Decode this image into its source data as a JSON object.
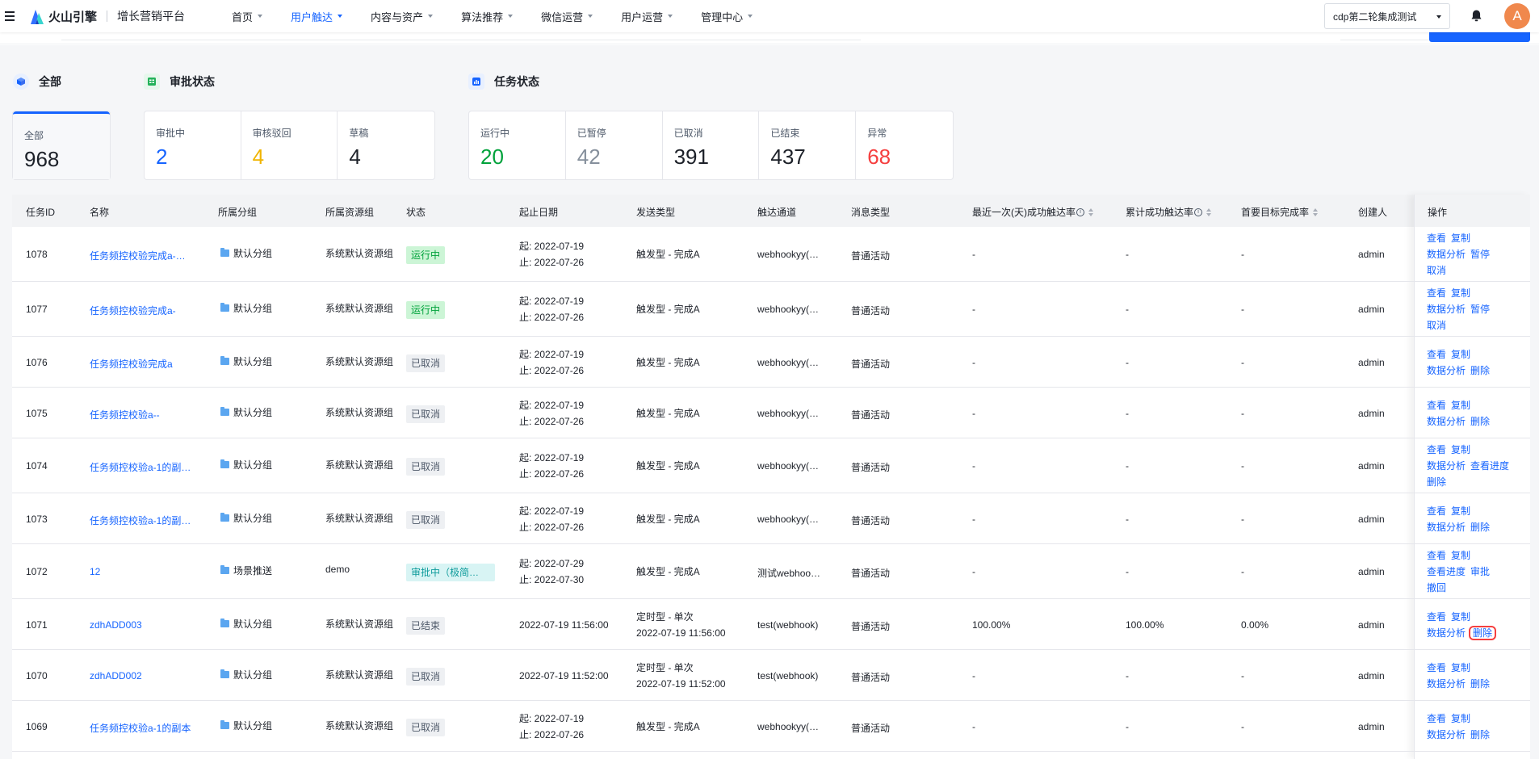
{
  "topnav": {
    "brand": "火山引擎",
    "platform": "增长营销平台",
    "menu": [
      "首页",
      "用户触达",
      "内容与资产",
      "算法推荐",
      "微信运营",
      "用户运营",
      "管理中心"
    ],
    "active_index": 1,
    "project": "cdp第二轮集成测试",
    "avatar_letter": "A"
  },
  "stats": {
    "all": {
      "title": "全部",
      "cards": [
        {
          "label": "全部",
          "value": "968"
        }
      ]
    },
    "approval": {
      "title": "审批状态",
      "cards": [
        {
          "label": "审批中",
          "value": "2",
          "color": "#1664ff"
        },
        {
          "label": "审核驳回",
          "value": "4",
          "color": "#f0b400"
        },
        {
          "label": "草稿",
          "value": "4",
          "color": "#1d2129"
        }
      ]
    },
    "task": {
      "title": "任务状态",
      "cards": [
        {
          "label": "运行中",
          "value": "20",
          "color": "#00a23b"
        },
        {
          "label": "已暂停",
          "value": "42",
          "color": "#86909c"
        },
        {
          "label": "已取消",
          "value": "391",
          "color": "#1d2129"
        },
        {
          "label": "已结束",
          "value": "437",
          "color": "#1d2129"
        },
        {
          "label": "异常",
          "value": "68",
          "color": "#f53f3f"
        }
      ]
    }
  },
  "table": {
    "headers": {
      "id": "任务ID",
      "name": "名称",
      "group": "所属分组",
      "resource": "所属资源组",
      "status": "状态",
      "date": "起止日期",
      "send_type": "发送类型",
      "channel": "触达通道",
      "msg_type": "消息类型",
      "recent_rate": "最近一次(天)成功触达率",
      "total_rate": "累计成功触达率",
      "goal_rate": "首要目标完成率",
      "creator": "创建人",
      "ops": "操作"
    },
    "rows": [
      {
        "id": "1078",
        "name": "任务频控校验完成a-…",
        "group": "默认分组",
        "resource": "系统默认资源组",
        "status": "运行中",
        "status_type": "run",
        "date1": "起: 2022-07-19",
        "date2": "止: 2022-07-26",
        "send1": "触发型 - 完成A",
        "send2": "",
        "channel": "webhookyy(…",
        "msg": "普通活动",
        "recent": "-",
        "total": "-",
        "goal": "-",
        "creator": "admin",
        "ops": [
          "查看",
          "复制",
          "数据分析",
          "暂停",
          "取消"
        ]
      },
      {
        "id": "1077",
        "name": "任务频控校验完成a-",
        "group": "默认分组",
        "resource": "系统默认资源组",
        "status": "运行中",
        "status_type": "run",
        "date1": "起: 2022-07-19",
        "date2": "止: 2022-07-26",
        "send1": "触发型 - 完成A",
        "send2": "",
        "channel": "webhookyy(…",
        "msg": "普通活动",
        "recent": "-",
        "total": "-",
        "goal": "-",
        "creator": "admin",
        "ops": [
          "查看",
          "复制",
          "数据分析",
          "暂停",
          "取消"
        ]
      },
      {
        "id": "1076",
        "name": "任务频控校验完成a",
        "group": "默认分组",
        "resource": "系统默认资源组",
        "status": "已取消",
        "status_type": "cancel",
        "date1": "起: 2022-07-19",
        "date2": "止: 2022-07-26",
        "send1": "触发型 - 完成A",
        "send2": "",
        "channel": "webhookyy(…",
        "msg": "普通活动",
        "recent": "-",
        "total": "-",
        "goal": "-",
        "creator": "admin",
        "ops": [
          "查看",
          "复制",
          "数据分析",
          "删除"
        ]
      },
      {
        "id": "1075",
        "name": "任务频控校验a--",
        "group": "默认分组",
        "resource": "系统默认资源组",
        "status": "已取消",
        "status_type": "cancel",
        "date1": "起: 2022-07-19",
        "date2": "止: 2022-07-26",
        "send1": "触发型 - 完成A",
        "send2": "",
        "channel": "webhookyy(…",
        "msg": "普通活动",
        "recent": "-",
        "total": "-",
        "goal": "-",
        "creator": "admin",
        "ops": [
          "查看",
          "复制",
          "数据分析",
          "删除"
        ]
      },
      {
        "id": "1074",
        "name": "任务频控校验a-1的副…",
        "group": "默认分组",
        "resource": "系统默认资源组",
        "status": "已取消",
        "status_type": "cancel",
        "date1": "起: 2022-07-19",
        "date2": "止: 2022-07-26",
        "send1": "触发型 - 完成A",
        "send2": "",
        "channel": "webhookyy(…",
        "msg": "普通活动",
        "recent": "-",
        "total": "-",
        "goal": "-",
        "creator": "admin",
        "ops": [
          "查看",
          "复制",
          "数据分析",
          "查看进度",
          "删除"
        ]
      },
      {
        "id": "1073",
        "name": "任务频控校验a-1的副…",
        "group": "默认分组",
        "resource": "系统默认资源组",
        "status": "已取消",
        "status_type": "cancel",
        "date1": "起: 2022-07-19",
        "date2": "止: 2022-07-26",
        "send1": "触发型 - 完成A",
        "send2": "",
        "channel": "webhookyy(…",
        "msg": "普通活动",
        "recent": "-",
        "total": "-",
        "goal": "-",
        "creator": "admin",
        "ops": [
          "查看",
          "复制",
          "数据分析",
          "删除"
        ]
      },
      {
        "id": "1072",
        "name": "12",
        "group": "场景推送",
        "resource": "demo",
        "status": "审批中（极简…",
        "status_type": "approve",
        "date1": "起: 2022-07-29",
        "date2": "止: 2022-07-30",
        "send1": "触发型 - 完成A",
        "send2": "",
        "channel": "测试webhoo…",
        "msg": "普通活动",
        "recent": "-",
        "total": "-",
        "goal": "-",
        "creator": "admin",
        "ops": [
          "查看",
          "复制",
          "查看进度",
          "审批",
          "撤回"
        ]
      },
      {
        "id": "1071",
        "name": "zdhADD003",
        "group": "默认分组",
        "resource": "系统默认资源组",
        "status": "已结束",
        "status_type": "end",
        "date1": "2022-07-19 11:56:00",
        "date2": "",
        "send1": "定时型 - 单次",
        "send2": "2022-07-19 11:56:00",
        "channel": "test(webhook)",
        "msg": "普通活动",
        "recent": "100.00%",
        "total": "100.00%",
        "goal": "0.00%",
        "creator": "admin",
        "ops": [
          "查看",
          "复制",
          "数据分析",
          "删除"
        ],
        "highlight_op": 3
      },
      {
        "id": "1070",
        "name": "zdhADD002",
        "group": "默认分组",
        "resource": "系统默认资源组",
        "status": "已取消",
        "status_type": "cancel",
        "date1": "2022-07-19 11:52:00",
        "date2": "",
        "send1": "定时型 - 单次",
        "send2": "2022-07-19 11:52:00",
        "channel": "test(webhook)",
        "msg": "普通活动",
        "recent": "-",
        "total": "-",
        "goal": "-",
        "creator": "admin",
        "ops": [
          "查看",
          "复制",
          "数据分析",
          "删除"
        ]
      },
      {
        "id": "1069",
        "name": "任务频控校验a-1的副本",
        "group": "默认分组",
        "resource": "系统默认资源组",
        "status": "已取消",
        "status_type": "cancel",
        "date1": "起: 2022-07-19",
        "date2": "止: 2022-07-26",
        "send1": "触发型 - 完成A",
        "send2": "",
        "channel": "webhookyy(…",
        "msg": "普通活动",
        "recent": "-",
        "total": "-",
        "goal": "-",
        "creator": "admin",
        "ops": [
          "查看",
          "复制",
          "数据分析",
          "删除"
        ]
      }
    ]
  }
}
